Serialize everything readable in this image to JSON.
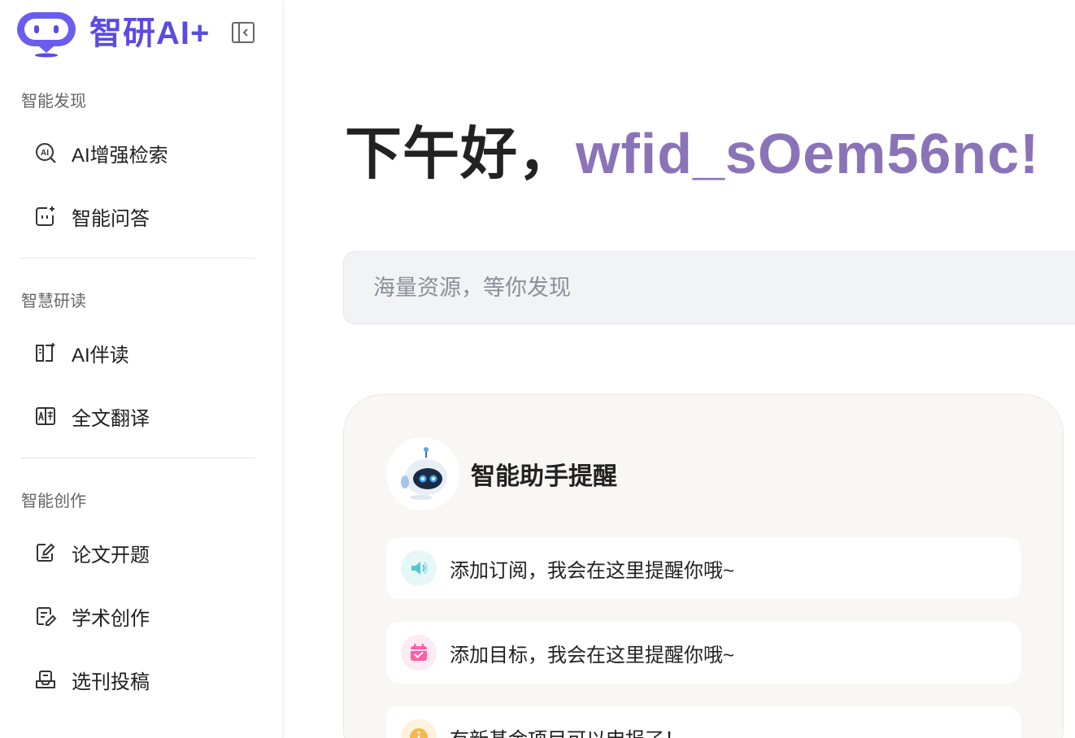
{
  "brand": {
    "name": "智研AI+",
    "logo_icon": "robot-logo-icon",
    "collapse_icon": "sidebar-collapse-icon"
  },
  "sidebar": {
    "sections": [
      {
        "title": "智能发现",
        "items": [
          {
            "label": "AI增强检索",
            "icon": "ai-search-icon"
          },
          {
            "label": "智能问答",
            "icon": "chat-sparkle-icon"
          }
        ]
      },
      {
        "title": "智慧研读",
        "items": [
          {
            "label": "AI伴读",
            "icon": "book-read-icon"
          },
          {
            "label": "全文翻译",
            "icon": "translate-icon"
          }
        ]
      },
      {
        "title": "智能创作",
        "items": [
          {
            "label": "论文开题",
            "icon": "edit-doc-icon"
          },
          {
            "label": "学术创作",
            "icon": "write-doc-icon"
          },
          {
            "label": "选刊投稿",
            "icon": "submit-tray-icon"
          }
        ]
      }
    ]
  },
  "main": {
    "greeting_prefix": "下午好，",
    "username": "wfid_sOem56nc!",
    "search": {
      "placeholder": "海量资源，等你发现",
      "value": ""
    },
    "assistant": {
      "title": "智能助手提醒",
      "avatar_icon": "robot-avatar-icon",
      "reminders": [
        {
          "text": "添加订阅，我会在这里提醒你哦~",
          "icon": "speaker-icon",
          "color": "#57c7cf"
        },
        {
          "text": "添加目标，我会在这里提醒你哦~",
          "icon": "calendar-check-icon",
          "color": "#ff5fa5"
        },
        {
          "text": "有新基金项目可以申报了！",
          "icon": "info-icon",
          "color": "#f5b94b"
        }
      ]
    }
  },
  "colors": {
    "brand": "#5b4be0",
    "username": "#8b73b8"
  }
}
